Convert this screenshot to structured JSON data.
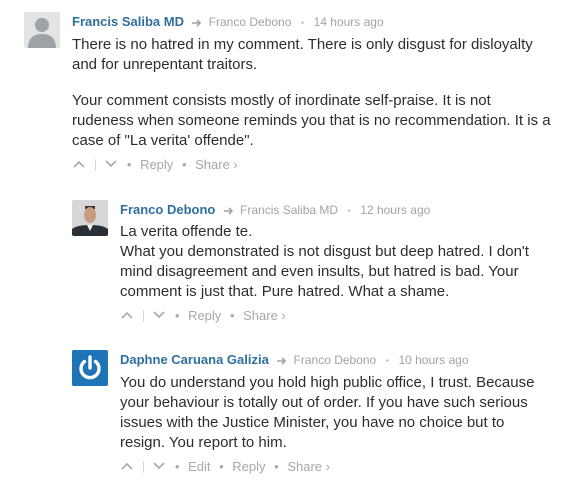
{
  "comments": [
    {
      "author": "Francis Saliba MD",
      "reply_to": "Franco Debono",
      "time": "14 hours ago",
      "paragraphs": [
        "There is no hatred in my comment. There is only disgust for disloyalty and for unrepentant traitors.",
        "Your comment consists mostly of inordinate self-praise. It is not rudeness when someone reminds you that is no recommendation. It is a case of \"La verita' offende\"."
      ],
      "actions": {
        "reply": "Reply",
        "share": "Share ›"
      }
    },
    {
      "author": "Franco Debono",
      "reply_to": "Francis Saliba MD",
      "time": "12 hours ago",
      "lines": [
        "La verita offende te.",
        "What you demonstrated is not disgust but deep hatred. I don't mind disagreement and even insults, but hatred is bad. Your comment is just that. Pure hatred. What a shame."
      ],
      "actions": {
        "reply": "Reply",
        "share": "Share ›"
      }
    },
    {
      "author": "Daphne Caruana Galizia",
      "reply_to": "Franco Debono",
      "time": "10 hours ago",
      "paragraphs": [
        "You do understand you hold high public office, I trust. Because your behaviour is totally out of order. If you have such serious issues with the Justice Minister, you have no choice but to resign. You report to him."
      ],
      "actions": {
        "edit": "Edit",
        "reply": "Reply",
        "share": "Share ›"
      }
    }
  ],
  "icons": {
    "reply_arrow": "reply-arrow-icon",
    "upvote": "chevron-up-icon",
    "downvote": "chevron-down-icon"
  },
  "colors": {
    "author": "#2f6f9f",
    "meta": "#a0a4a6",
    "text": "#2a2e2e",
    "daphne_avatar": "#1f74b8"
  }
}
